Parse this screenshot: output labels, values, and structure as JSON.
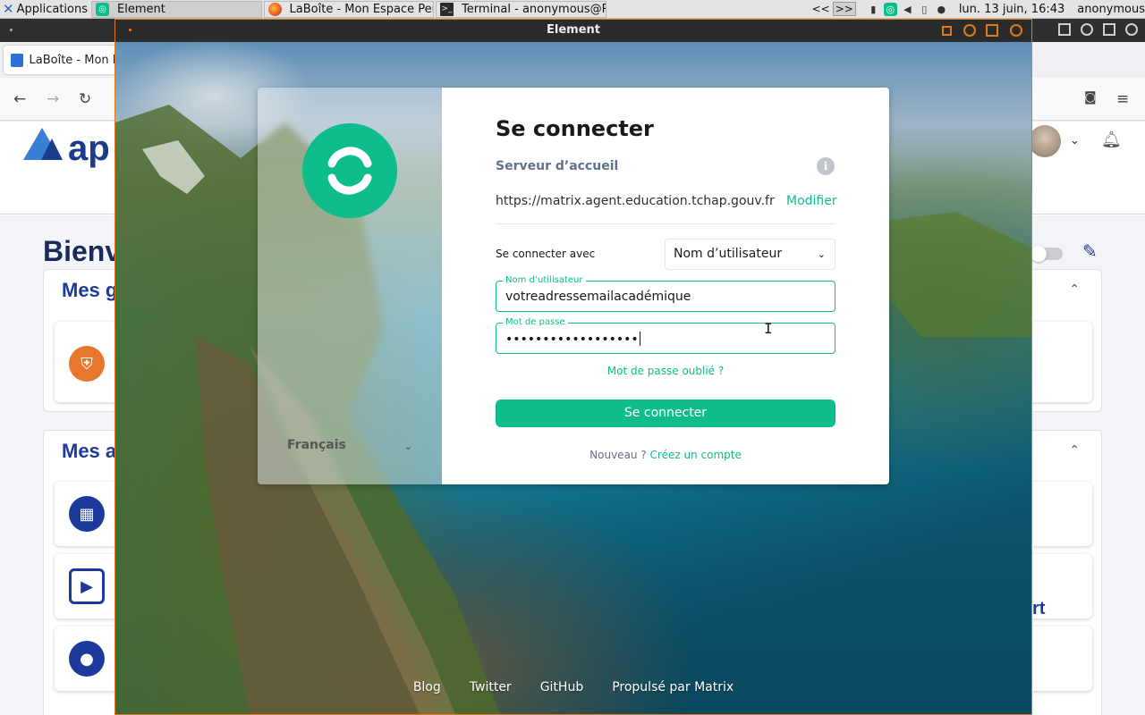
{
  "panel": {
    "apps_label": "Applications",
    "tasks": [
      {
        "label": "Element",
        "icon": "element-icon"
      },
      {
        "label": "LaBoîte - Mon Espace Per...",
        "icon": "firefox-icon"
      },
      {
        "label": "Terminal - anonymous@R...",
        "icon": "terminal-icon"
      }
    ],
    "arrows_left": "<<",
    "arrows_right": ">>",
    "clock": "lun. 13 juin, 16:43",
    "user": "anonymous"
  },
  "browser": {
    "tab_title": "LaBoîte - Mon E",
    "logo_text": "ap",
    "welcome": "Bienv",
    "groups_title": "Mes g",
    "apps_title": "Mes a",
    "tile_right_text": "rt"
  },
  "element": {
    "window_title": "Element",
    "auth": {
      "heading": "Se connecter",
      "server_label": "Serveur d’accueil",
      "server_url": "https://matrix.agent.education.tchap.gouv.fr",
      "edit_label": "Modifier",
      "login_with_label": "Se connecter avec",
      "login_with_value": "Nom d’utilisateur",
      "username_label": "Nom d’utilisateur",
      "username_value": "votreadressemailacadémique",
      "password_label": "Mot de passe",
      "password_value": "••••••••••••••••••",
      "forgot_label": "Mot de passe oublié ?",
      "submit_label": "Se connecter",
      "new_label": "Nouveau ?",
      "create_account_label": "Créez un compte",
      "language": "Français"
    },
    "footer": {
      "links": [
        "Blog",
        "Twitter",
        "GitHub",
        "Propulsé par Matrix"
      ]
    }
  },
  "colors": {
    "accent": "#0dbd8b",
    "window_border": "#e07a1f",
    "heading_blue": "#1b3a9c"
  }
}
